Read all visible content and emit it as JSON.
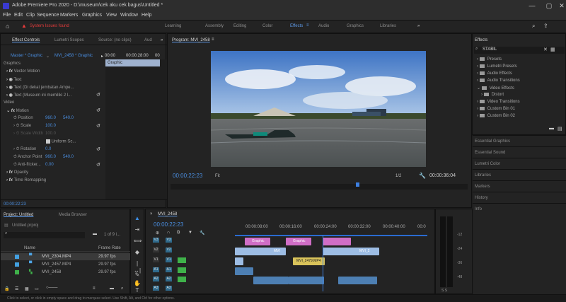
{
  "window": {
    "title": "Adobe Premiere Pro 2020 - D:\\museum\\cek aku cek bagus\\Untitled *",
    "controls": [
      "—",
      "▢",
      "✕"
    ]
  },
  "menu": [
    "File",
    "Edit",
    "Clip",
    "Sequence",
    "Markers",
    "Graphics",
    "View",
    "Window",
    "Help"
  ],
  "alert": "System Issues found",
  "workspaces": [
    "Learning",
    "Assembly",
    "Editing",
    "Color",
    "Effects",
    "Audio",
    "Graphics",
    "Libraries",
    "»"
  ],
  "effect_controls": {
    "tabs": [
      "Effect Controls",
      "Lumetri Scopes",
      "Source: (no clips)",
      "Aud",
      "»"
    ],
    "master": "Master * Graphic",
    "clip": "MVI_2458 * Graphic",
    "time_start": "00:00",
    "time_end": "00:00:28:00",
    "clip_label": "Graphic",
    "graphics_label": "Graphics",
    "vector_motion": "Vector Motion",
    "text1": "Text",
    "text2": "Text (Di dekat jembatan Ampe...",
    "text3": "Text (Museum ini memiliki 2 l...",
    "video_label": "Video",
    "motion": "Motion",
    "position_label": "Position",
    "position_x": "960.0",
    "position_y": "540.0",
    "scale_label": "Scale",
    "scale_value": "100.0",
    "scale_width_label": "Scale Width",
    "scale_width_value": "100.0",
    "uniform_label": "Uniform Sc...",
    "rotation_label": "Rotation",
    "rotation_value": "0.0",
    "anchor_label": "Anchor Point",
    "anchor_x": "960.0",
    "anchor_y": "540.0",
    "antiflicker_label": "Anti-flicker...",
    "antiflicker_value": "0.00",
    "opacity": "Opacity",
    "time_remapping": "Time Remapping",
    "timecode": "00:00:22:23"
  },
  "program": {
    "title": "Program: MVI_2458",
    "timecode": "00:00:22:23",
    "fit": "Fit",
    "quality": "1/2",
    "duration": "00:00:36:04"
  },
  "effects": {
    "title": "Effects",
    "search": "STABIL",
    "items": [
      "Presets",
      "Lumetri Presets",
      "Audio Effects",
      "Audio Transitions",
      "Video Effects",
      "Distort",
      "Video Transitions",
      "Custom Bin 01",
      "Custom Bin 02"
    ],
    "sections": [
      "Essential Graphics",
      "Essential Sound",
      "Lumetri Color",
      "Libraries",
      "Markers",
      "History",
      "Info"
    ]
  },
  "project": {
    "tabs": [
      "Project: Untitled",
      "Media Browser"
    ],
    "file": "Untitled.prproj",
    "count": "1 of 9 i...",
    "col_name": "Name",
    "col_rate": "Frame Rate",
    "rows": [
      {
        "name": "MVI_2304.MP4",
        "rate": "29.97 fps",
        "color": "#43a0e0"
      },
      {
        "name": "MVI_2457.MP4",
        "rate": "29.97 fps",
        "color": "#43a0e0"
      },
      {
        "name": "MVI_2458",
        "rate": "29.97 fps",
        "color": "#3fb24a"
      }
    ]
  },
  "timeline": {
    "title": "MVI_2458",
    "timecode": "00:00:22:23",
    "ruler": [
      "00:00:08:00",
      "00:00:16:00",
      "00:00:24:00",
      "00:00:32:00",
      "00:00:40:00",
      "00:0"
    ],
    "tracks": [
      "V3",
      "V2",
      "V1",
      "A1",
      "A2",
      "A3"
    ],
    "clips": {
      "v1a": "MVI",
      "v1b": "MVI_2",
      "v2": "MVI_2479.MP4",
      "v3a": "Graphic",
      "v3b": "Graphic"
    }
  },
  "meter": {
    "labels": [
      "-12",
      "-24",
      "-36",
      "-48"
    ],
    "bottom": "S S"
  },
  "status": "Click to select, or click in empty space and drag to marquee select. Use Shift, Alt, and Ctrl for other options."
}
